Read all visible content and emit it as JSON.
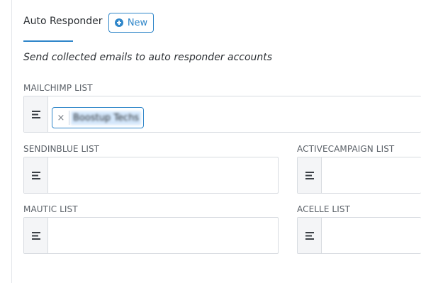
{
  "header": {
    "title": "Auto Responder",
    "new_button_label": "New"
  },
  "description": "Send collected emails to auto responder accounts",
  "fields": {
    "mailchimp": {
      "label": "MAILCHIMP LIST",
      "tags": [
        "Boostup Techs"
      ],
      "remove_glyph": "×"
    },
    "sendinblue": {
      "label": "SENDINBLUE LIST",
      "value": ""
    },
    "activecampaign": {
      "label": "ACTIVECAMPAIGN LIST",
      "value": ""
    },
    "mautic": {
      "label": "MAUTIC LIST",
      "value": ""
    },
    "acelle": {
      "label": "ACELLE LIST",
      "value": ""
    }
  },
  "colors": {
    "accent": "#2f86c9",
    "text": "#2b2f33",
    "label": "#5b6168",
    "border": "#d7dbe0",
    "handle_bg": "#f4f5f7"
  },
  "icons": {
    "new": "plus-circle-icon",
    "handle": "align-left-icon",
    "remove": "close-icon"
  }
}
